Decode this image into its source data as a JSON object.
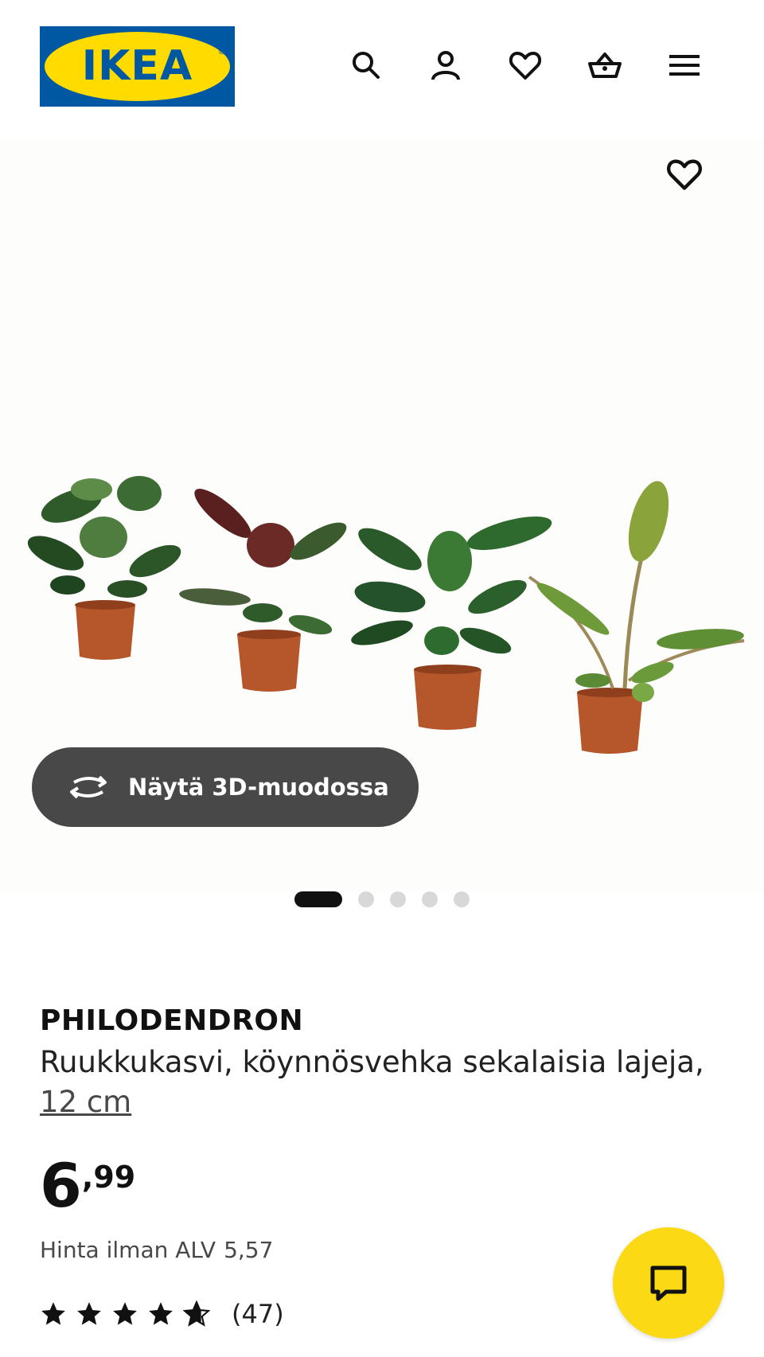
{
  "header": {
    "logo_text": "IKEA",
    "logo_reg": "®",
    "icons": [
      "search-icon",
      "account-icon",
      "wishlist-heart-icon",
      "shopping-basket-icon",
      "hamburger-menu-icon"
    ]
  },
  "gallery": {
    "favourite_icon": "heart-outline-icon",
    "view_3d_label": "Näytä 3D-muodossa",
    "view_3d_icon": "rotate-arrows-icon",
    "slide_count": 5,
    "active_slide": 1
  },
  "product": {
    "brand": "PHILODENDRON",
    "description": "Ruukkukasvi, köynnösvehka sekalaisia lajeja,",
    "size_link": "12 cm",
    "price_integer": "6",
    "price_decimal": ",99",
    "vat_label": "Hinta ilman ALV",
    "vat_value": "5,57",
    "rating_stars": 4.7,
    "rating_count": "(47)"
  },
  "colors": {
    "ikea_blue": "#0058a3",
    "ikea_yellow": "#ffdb00",
    "button_dark": "#484848",
    "chat_yellow": "#fbd914"
  },
  "chat": {
    "icon": "chat-bubble-icon"
  }
}
